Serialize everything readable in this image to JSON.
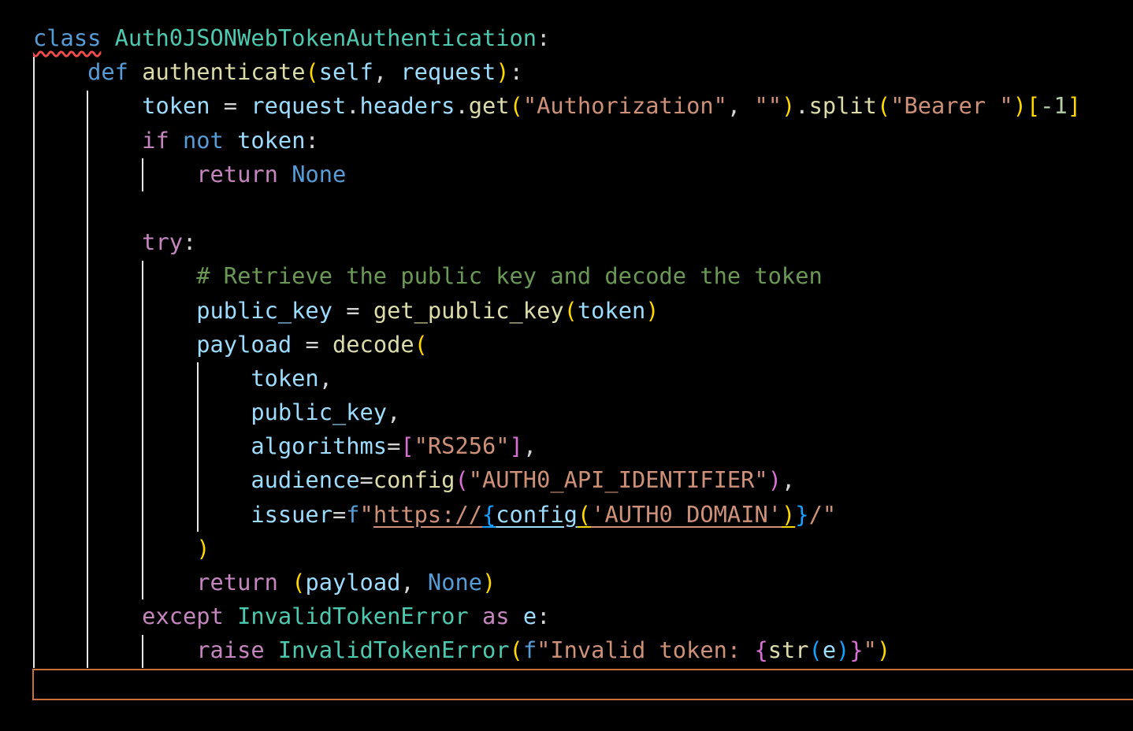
{
  "editor": {
    "lines": [
      {
        "t": [
          [
            "kw",
            "class"
          ],
          [
            "sp",
            " "
          ],
          [
            "cls",
            "Auth0JSONWebTokenAuthentication"
          ],
          [
            "punc",
            ":"
          ]
        ]
      },
      {
        "t": [
          [
            "ind",
            "    "
          ],
          [
            "kw",
            "def"
          ],
          [
            "sp",
            " "
          ],
          [
            "fn",
            "authenticate"
          ],
          [
            "br1",
            "("
          ],
          [
            "var",
            "self"
          ],
          [
            "punc",
            ", "
          ],
          [
            "var",
            "request"
          ],
          [
            "br1",
            ")"
          ],
          [
            "punc",
            ":"
          ]
        ]
      },
      {
        "t": [
          [
            "ind",
            "        "
          ],
          [
            "var",
            "token"
          ],
          [
            "punc",
            " = "
          ],
          [
            "var",
            "request"
          ],
          [
            "punc",
            "."
          ],
          [
            "var",
            "headers"
          ],
          [
            "punc",
            "."
          ],
          [
            "fn",
            "get"
          ],
          [
            "br1",
            "("
          ],
          [
            "str",
            "\"Authorization\""
          ],
          [
            "punc",
            ", "
          ],
          [
            "str",
            "\"\""
          ],
          [
            "br1",
            ")"
          ],
          [
            "punc",
            "."
          ],
          [
            "fn",
            "split"
          ],
          [
            "br1",
            "("
          ],
          [
            "str",
            "\"Bearer \""
          ],
          [
            "br1",
            ")"
          ],
          [
            "br1",
            "["
          ],
          [
            "num",
            "-1"
          ],
          [
            "br1",
            "]"
          ]
        ]
      },
      {
        "t": [
          [
            "ind",
            "        "
          ],
          [
            "kw2",
            "if"
          ],
          [
            "sp",
            " "
          ],
          [
            "kw",
            "not"
          ],
          [
            "sp",
            " "
          ],
          [
            "var",
            "token"
          ],
          [
            "punc",
            ":"
          ]
        ]
      },
      {
        "t": [
          [
            "ind",
            "            "
          ],
          [
            "kw2",
            "return"
          ],
          [
            "sp",
            " "
          ],
          [
            "kw",
            "None"
          ]
        ]
      },
      {
        "t": []
      },
      {
        "t": [
          [
            "ind",
            "        "
          ],
          [
            "kw2",
            "try"
          ],
          [
            "punc",
            ":"
          ]
        ]
      },
      {
        "t": [
          [
            "ind",
            "            "
          ],
          [
            "cmt",
            "# Retrieve the public key and decode the token"
          ]
        ]
      },
      {
        "t": [
          [
            "ind",
            "            "
          ],
          [
            "var",
            "public_key"
          ],
          [
            "punc",
            " = "
          ],
          [
            "fn",
            "get_public_key"
          ],
          [
            "br1",
            "("
          ],
          [
            "var",
            "token"
          ],
          [
            "br1",
            ")"
          ]
        ]
      },
      {
        "t": [
          [
            "ind",
            "            "
          ],
          [
            "var",
            "payload"
          ],
          [
            "punc",
            " = "
          ],
          [
            "fn",
            "decode"
          ],
          [
            "br1",
            "("
          ]
        ]
      },
      {
        "t": [
          [
            "ind",
            "                "
          ],
          [
            "var",
            "token"
          ],
          [
            "punc",
            ","
          ]
        ]
      },
      {
        "t": [
          [
            "ind",
            "                "
          ],
          [
            "var",
            "public_key"
          ],
          [
            "punc",
            ","
          ]
        ]
      },
      {
        "t": [
          [
            "ind",
            "                "
          ],
          [
            "var",
            "algorithms"
          ],
          [
            "punc",
            "="
          ],
          [
            "br2",
            "["
          ],
          [
            "str",
            "\"RS256\""
          ],
          [
            "br2",
            "]"
          ],
          [
            "punc",
            ","
          ]
        ]
      },
      {
        "t": [
          [
            "ind",
            "                "
          ],
          [
            "var",
            "audience"
          ],
          [
            "punc",
            "="
          ],
          [
            "fn",
            "config"
          ],
          [
            "br2",
            "("
          ],
          [
            "str",
            "\"AUTH0_API_IDENTIFIER\""
          ],
          [
            "br2",
            ")"
          ],
          [
            "punc",
            ","
          ]
        ]
      },
      {
        "t": [
          [
            "ind",
            "                "
          ],
          [
            "var",
            "issuer"
          ],
          [
            "punc",
            "="
          ],
          [
            "kw",
            "f"
          ],
          [
            "str",
            "\""
          ],
          [
            "strl",
            "https://"
          ],
          [
            "br3l",
            "{"
          ],
          [
            "fnl",
            "config"
          ],
          [
            "br1l",
            "("
          ],
          [
            "strl",
            "'AUTH0_DOMAIN'"
          ],
          [
            "br1l",
            ")"
          ],
          [
            "br3",
            "}"
          ],
          [
            "str",
            "/\""
          ]
        ]
      },
      {
        "t": [
          [
            "ind",
            "            "
          ],
          [
            "br1",
            ")"
          ]
        ]
      },
      {
        "t": [
          [
            "ind",
            "            "
          ],
          [
            "kw2",
            "return"
          ],
          [
            "sp",
            " "
          ],
          [
            "br1",
            "("
          ],
          [
            "var",
            "payload"
          ],
          [
            "punc",
            ", "
          ],
          [
            "kw",
            "None"
          ],
          [
            "br1",
            ")"
          ]
        ]
      },
      {
        "t": [
          [
            "ind",
            "        "
          ],
          [
            "kw2",
            "except"
          ],
          [
            "sp",
            " "
          ],
          [
            "cls",
            "InvalidTokenError"
          ],
          [
            "sp",
            " "
          ],
          [
            "kw2",
            "as"
          ],
          [
            "sp",
            " "
          ],
          [
            "var",
            "e"
          ],
          [
            "punc",
            ":"
          ]
        ]
      },
      {
        "t": [
          [
            "ind",
            "            "
          ],
          [
            "kw2",
            "raise"
          ],
          [
            "sp",
            " "
          ],
          [
            "cls",
            "InvalidTokenError"
          ],
          [
            "br1",
            "("
          ],
          [
            "kw",
            "f"
          ],
          [
            "str",
            "\"Invalid token: "
          ],
          [
            "br2",
            "{"
          ],
          [
            "fn",
            "str"
          ],
          [
            "br3",
            "("
          ],
          [
            "var",
            "e"
          ],
          [
            "br3",
            ")"
          ],
          [
            "br2",
            "}"
          ],
          [
            "str",
            "\""
          ],
          [
            "br1",
            ")"
          ]
        ]
      }
    ]
  },
  "colors": {
    "background": "#000000",
    "current_line_border": "#c8703a",
    "indent_guide": "#e8e8e8",
    "error_squiggle": "#f14c4c"
  }
}
